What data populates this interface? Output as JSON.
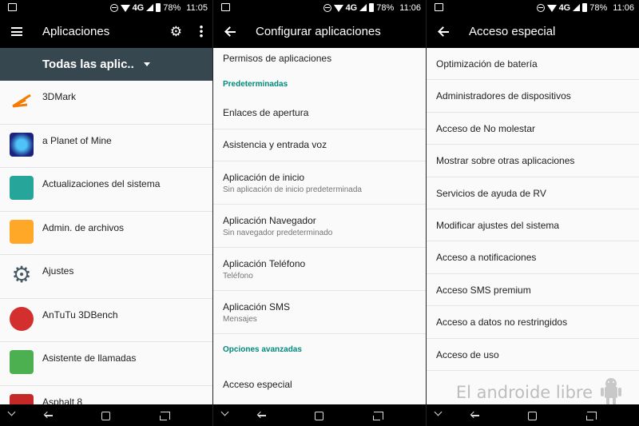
{
  "status": {
    "panel1": {
      "network": "4G",
      "battery": "78%",
      "time": "11:05"
    },
    "panel2": {
      "network": "4G",
      "battery": "78%",
      "time": "11:06"
    },
    "panel3": {
      "network": "4G",
      "battery": "78%",
      "time": "11:06"
    }
  },
  "apps_screen": {
    "title": "Aplicaciones",
    "filter_label": "Todas las aplic..",
    "apps": [
      {
        "name": "3DMark",
        "icon": "3dmark-icon",
        "color": "#f57c00"
      },
      {
        "name": "a Planet of Mine",
        "icon": "planet-icon",
        "color": "#1a237e"
      },
      {
        "name": "Actualizaciones del sistema",
        "icon": "system-update-icon",
        "color": "#26a69a"
      },
      {
        "name": "Admin. de archivos",
        "icon": "folder-icon",
        "color": "#ffa726"
      },
      {
        "name": "Ajustes",
        "icon": "gear-icon",
        "color": "#455a64"
      },
      {
        "name": "AnTuTu 3DBench",
        "icon": "antutu-icon",
        "color": "#d32f2f"
      },
      {
        "name": "Asistente de llamadas",
        "icon": "call-assistant-icon",
        "color": "#4caf50"
      },
      {
        "name": "Asphalt 8",
        "icon": "asphalt-icon",
        "color": "#c62828"
      }
    ]
  },
  "configure_screen": {
    "title": "Configurar aplicaciones",
    "items": [
      {
        "type": "item",
        "title": "Permisos de aplicaciones",
        "subtitle": ""
      },
      {
        "type": "header",
        "title": "Predeterminadas"
      },
      {
        "type": "item",
        "title": "Enlaces de apertura",
        "subtitle": ""
      },
      {
        "type": "item",
        "title": "Asistencia y entrada voz",
        "subtitle": ""
      },
      {
        "type": "item",
        "title": "Aplicación de inicio",
        "subtitle": "Sin aplicación de inicio predeterminada"
      },
      {
        "type": "item",
        "title": "Aplicación Navegador",
        "subtitle": "Sin navegador predeterminado"
      },
      {
        "type": "item",
        "title": "Aplicación Teléfono",
        "subtitle": "Teléfono"
      },
      {
        "type": "item",
        "title": "Aplicación SMS",
        "subtitle": "Mensajes"
      },
      {
        "type": "header",
        "title": "Opciones avanzadas"
      },
      {
        "type": "item",
        "title": "Acceso especial",
        "subtitle": ""
      }
    ]
  },
  "special_access_screen": {
    "title": "Acceso especial",
    "items": [
      "Optimización de batería",
      "Administradores de dispositivos",
      "Acceso de No molestar",
      "Mostrar sobre otras aplicaciones",
      "Servicios de ayuda de RV",
      "Modificar ajustes del sistema",
      "Acceso a notificaciones",
      "Acceso SMS premium",
      "Acceso a datos no restringidos",
      "Acceso de uso"
    ]
  },
  "watermark": "El androide libre"
}
